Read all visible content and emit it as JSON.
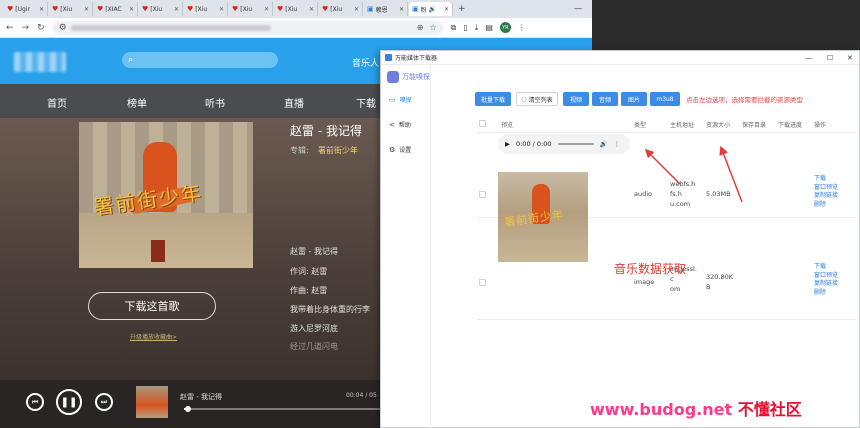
{
  "browser": {
    "tabs": [
      {
        "label": "[Ugir",
        "active": false
      },
      {
        "label": "[Xiu",
        "active": false
      },
      {
        "label": "[XIAC",
        "active": false
      },
      {
        "label": "[Xiu",
        "active": false
      },
      {
        "label": "[Xiu",
        "active": false
      },
      {
        "label": "[Xiu",
        "active": false
      },
      {
        "label": "[Xiu",
        "active": false
      },
      {
        "label": "[Xiu",
        "active": false
      },
      {
        "label": "赖恩",
        "active": false
      },
      {
        "label": "粉",
        "active": true
      }
    ],
    "new_tab": "+",
    "minimize": "—",
    "avatar_text": "YR"
  },
  "site": {
    "search_placeholder": "",
    "top_link": "音乐人",
    "nav": [
      "首页",
      "榜单",
      "听书",
      "直播",
      "下载"
    ],
    "song_title": "赵雷 - 我记得",
    "album_label": "专辑:",
    "album_name": "署前街少年",
    "cover_art_text": "署前街少年",
    "lyrics": [
      "赵雷 - 我记得",
      "作词:  赵雷",
      "作曲:  赵雷",
      "我带着比身体重的行李",
      "游入尼罗河底",
      "经过几道闪电"
    ],
    "download_button": "下载这首歌",
    "download_link": "升级播放收藏曲>",
    "mini_title": "赵雷 - 我记得",
    "mini_time": "00:04 / 05",
    "progress": 0.02
  },
  "downloader": {
    "window_title": "万能媒体下载器",
    "brand": "万能嗅探",
    "sidebar": [
      {
        "label": "嗅探",
        "icon": "sniff-icon",
        "active": true
      },
      {
        "label": "帮助",
        "icon": "share-icon",
        "active": false
      },
      {
        "label": "设置",
        "icon": "gear-icon",
        "active": false
      }
    ],
    "toolbar": {
      "batch": "批量下载",
      "clear": "清空列表",
      "video": "视频",
      "audio": "音频",
      "image": "图片",
      "m3u8": "m3u8"
    },
    "hint": "点击左边选项，选择需要拦截的资源类型",
    "columns": [
      "预览",
      "类型",
      "主机地址",
      "资源大小",
      "保存目录",
      "下载进度",
      "操作"
    ],
    "rows": [
      {
        "type": "audio",
        "host": [
          "webfs.h",
          "u.com"
        ],
        "size": "5.03MB",
        "audio_time": "0:00 / 0:00",
        "actions": [
          "下载",
          "窗口预览",
          "复制链接",
          "删除"
        ]
      },
      {
        "type": "image",
        "host": [
          "imgessl.",
          "om"
        ],
        "size": [
          "320.80K",
          "B"
        ],
        "actions": [
          "下载",
          "窗口预览",
          "复制链接",
          "删除"
        ]
      }
    ]
  },
  "annotation": "音乐数据获取",
  "watermark": {
    "url": "www.budog.net",
    "name": "不懂社区"
  },
  "colors": {
    "site_blue": "#28a0ea",
    "accent_blue": "#3c8ce7",
    "annotation_red": "#e43a3a"
  }
}
